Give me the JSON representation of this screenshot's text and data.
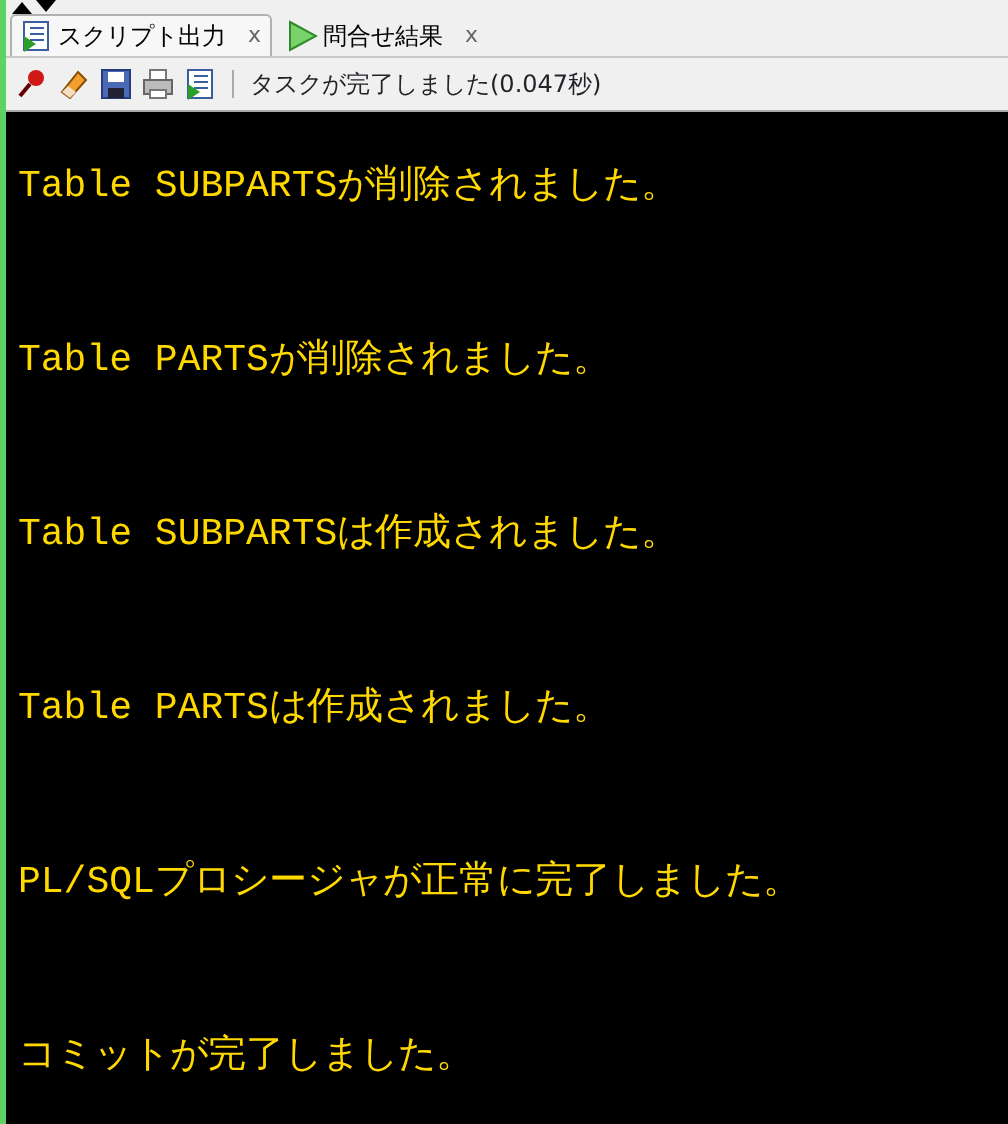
{
  "tabs": [
    {
      "label": "スクリプト出力",
      "close": "x",
      "selected": true
    },
    {
      "label": "問合せ結果",
      "close": "x",
      "selected": false
    }
  ],
  "toolbar": {
    "status": "タスクが完了しました(0.047秒)"
  },
  "output": [
    "Table SUBPARTSが削除されました。",
    "Table PARTSが削除されました。",
    "Table SUBPARTSは作成されました。",
    "Table PARTSは作成されました。",
    "PL/SQLプロシージャが正常に完了しました。",
    "コミットが完了しました。"
  ]
}
